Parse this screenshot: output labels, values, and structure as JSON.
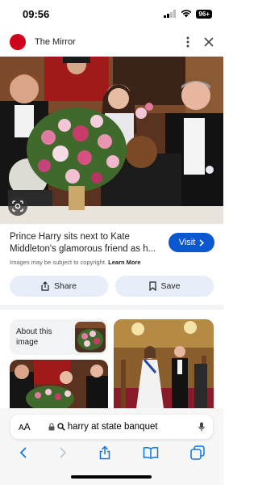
{
  "status_bar": {
    "time": "09:56",
    "battery": "96+",
    "icons": [
      "signal-icon",
      "wifi-icon",
      "battery-icon"
    ]
  },
  "header": {
    "site_logo_text": "Mirror",
    "site_name": "The Mirror",
    "icons": [
      "more-options-icon",
      "close-icon"
    ]
  },
  "main_image": {
    "description_icon": "lens-icon"
  },
  "result": {
    "title": "Prince Harry sits next to Kate Middleton's glamorous friend as h...",
    "visit_label": "Visit",
    "copyright_text": "Images may be subject to copyright.",
    "learn_more_label": "Learn More"
  },
  "actions": {
    "share_label": "Share",
    "save_label": "Save"
  },
  "related": {
    "about_label": "About this image"
  },
  "browser": {
    "text_size_small": "A",
    "text_size_large": "A",
    "query": "harry at state banquet"
  },
  "colors": {
    "accent": "#0b57d0",
    "button_bg": "#e8eef9",
    "logo_red": "#d0021b"
  }
}
